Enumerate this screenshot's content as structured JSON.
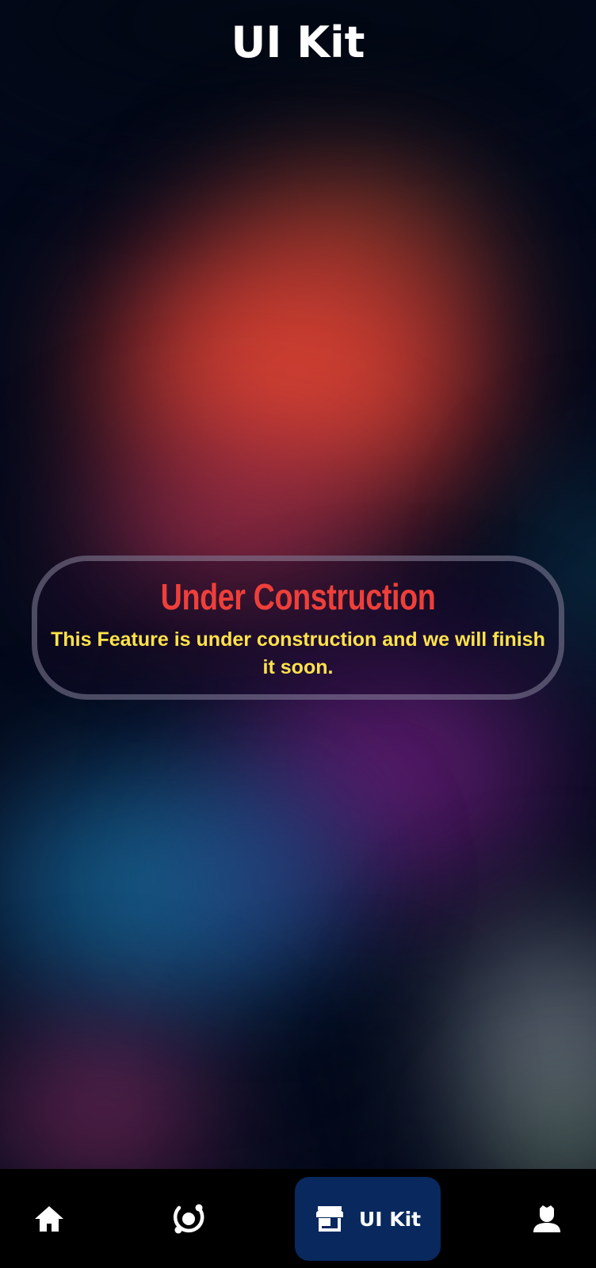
{
  "header": {
    "title": "UI Kit"
  },
  "notice": {
    "title": "Under Construction",
    "message": "This Feature is under construction and we will finish it soon."
  },
  "bottom_nav": {
    "items": [
      {
        "id": "home",
        "icon": "home-icon",
        "label": "",
        "active": false
      },
      {
        "id": "explore",
        "icon": "orbit-icon",
        "label": "",
        "active": false
      },
      {
        "id": "ui-kit",
        "icon": "store-icon",
        "label": "UI Kit",
        "active": true
      },
      {
        "id": "profile",
        "icon": "user-icon",
        "label": "",
        "active": false
      }
    ]
  },
  "colors": {
    "notice_title": "#ee3f3a",
    "notice_message": "#ffe34a",
    "active_tab_bg": "#08285e",
    "navbar_bg": "#000000"
  }
}
